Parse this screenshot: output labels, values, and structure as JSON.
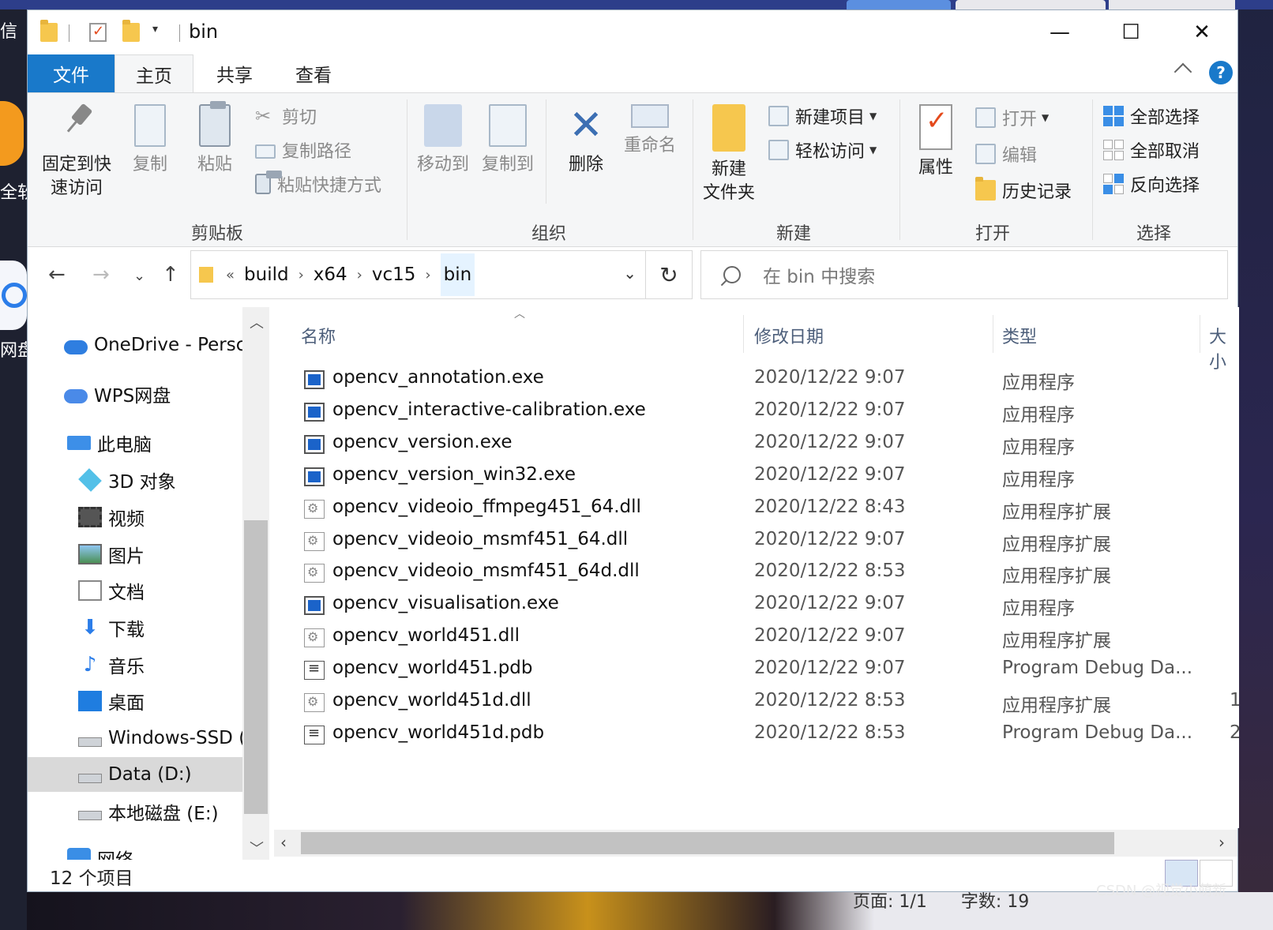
{
  "window": {
    "title": "bin"
  },
  "desktop": {
    "left_text_1": "信",
    "left_text_2": "全软",
    "left_text_3": "网盘",
    "bottom_page": "页面: 1/1",
    "bottom_words": "字数: 19",
    "watermark": "CSDN @视觉小萌新"
  },
  "ribbon": {
    "tabs": [
      "文件",
      "主页",
      "共享",
      "查看"
    ],
    "help": "?",
    "clipboard": {
      "pin_line1": "固定到快",
      "pin_line2": "速访问",
      "copy": "复制",
      "paste": "粘贴",
      "cut": "剪切",
      "copy_path": "复制路径",
      "paste_shortcut": "粘贴快捷方式",
      "group": "剪贴板"
    },
    "organize": {
      "move_to": "移动到",
      "copy_to": "复制到",
      "delete": "删除",
      "rename": "重命名",
      "group": "组织"
    },
    "new": {
      "new_folder_line1": "新建",
      "new_folder_line2": "文件夹",
      "new_item": "新建项目",
      "easy_access": "轻松访问",
      "group": "新建"
    },
    "open": {
      "properties": "属性",
      "open": "打开",
      "edit": "编辑",
      "history": "历史记录",
      "group": "打开"
    },
    "select": {
      "select_all": "全部选择",
      "select_none": "全部取消",
      "invert": "反向选择",
      "group": "选择"
    }
  },
  "address": {
    "overflow": "«",
    "crumbs": [
      "build",
      "x64",
      "vc15",
      "bin"
    ],
    "search_placeholder": "在 bin 中搜索"
  },
  "nav": {
    "items": [
      "OneDrive - Persc",
      "WPS网盘",
      "此电脑",
      "3D 对象",
      "视频",
      "图片",
      "文档",
      "下载",
      "音乐",
      "桌面",
      "Windows-SSD (",
      "Data (D:)",
      "本地磁盘 (E:)",
      "网络"
    ],
    "selected": "Data (D:)"
  },
  "files": {
    "columns": [
      "名称",
      "修改日期",
      "类型",
      "大小"
    ],
    "rows": [
      {
        "name": "opencv_annotation.exe",
        "date": "2020/12/22 9:07",
        "type": "应用程序",
        "size": "",
        "icon": "exe-icon"
      },
      {
        "name": "opencv_interactive-calibration.exe",
        "date": "2020/12/22 9:07",
        "type": "应用程序",
        "size": "",
        "icon": "exe-icon"
      },
      {
        "name": "opencv_version.exe",
        "date": "2020/12/22 9:07",
        "type": "应用程序",
        "size": "",
        "icon": "exe-icon"
      },
      {
        "name": "opencv_version_win32.exe",
        "date": "2020/12/22 9:07",
        "type": "应用程序",
        "size": "",
        "icon": "exe-icon"
      },
      {
        "name": "opencv_videoio_ffmpeg451_64.dll",
        "date": "2020/12/22 8:43",
        "type": "应用程序扩展",
        "size": "",
        "icon": "dll-icon"
      },
      {
        "name": "opencv_videoio_msmf451_64.dll",
        "date": "2020/12/22 9:07",
        "type": "应用程序扩展",
        "size": "",
        "icon": "dll-icon"
      },
      {
        "name": "opencv_videoio_msmf451_64d.dll",
        "date": "2020/12/22 8:53",
        "type": "应用程序扩展",
        "size": "",
        "icon": "dll-icon"
      },
      {
        "name": "opencv_visualisation.exe",
        "date": "2020/12/22 9:07",
        "type": "应用程序",
        "size": "",
        "icon": "exe-icon"
      },
      {
        "name": "opencv_world451.dll",
        "date": "2020/12/22 9:07",
        "type": "应用程序扩展",
        "size": "",
        "icon": "dll-icon"
      },
      {
        "name": "opencv_world451.pdb",
        "date": "2020/12/22 9:07",
        "type": "Program Debug Da...",
        "size": "",
        "icon": "pdb-icon"
      },
      {
        "name": "opencv_world451d.dll",
        "date": "2020/12/22 8:53",
        "type": "应用程序扩展",
        "size": "1",
        "icon": "dll-icon"
      },
      {
        "name": "opencv_world451d.pdb",
        "date": "2020/12/22 8:53",
        "type": "Program Debug Da...",
        "size": "2",
        "icon": "pdb-icon"
      }
    ]
  },
  "status": {
    "count": "12 个项目"
  },
  "colors": {
    "accent": "#1979ca",
    "selection": "#e5f3ff",
    "exe_blue": "#1b63c9",
    "folder_yellow": "#f6c74e"
  }
}
